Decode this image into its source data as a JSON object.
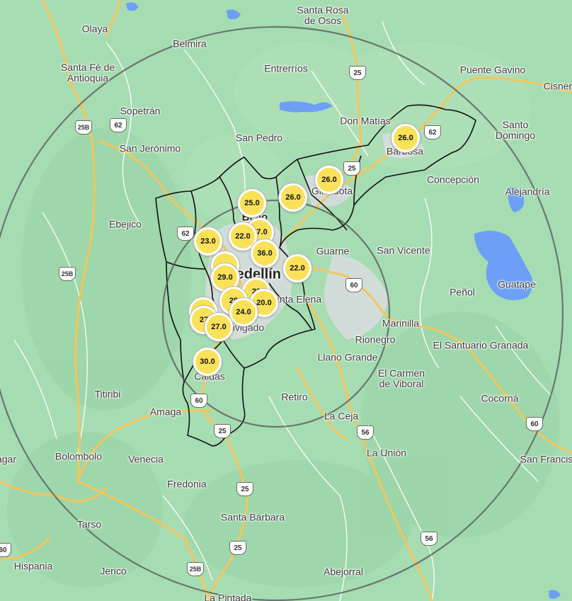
{
  "colors": {
    "land": "#a6dcb2",
    "road": "#f4c55b",
    "water": "#6c9ff5",
    "range_ring": "#555555",
    "boundary": "#111111",
    "marker_fill": "#f9e259"
  },
  "towns": [
    {
      "id": "santa-rosa",
      "label": "Santa Rosa\nde Osos"
    },
    {
      "id": "olaya",
      "label": "Olaya"
    },
    {
      "id": "belmira",
      "label": "Belmira"
    },
    {
      "id": "santa-fe",
      "label": "Santa Fé de\nAntioquia"
    },
    {
      "id": "entrerrios",
      "label": "Entrerríos"
    },
    {
      "id": "puente-gavino",
      "label": "Puente Gavino"
    },
    {
      "id": "cisner",
      "label": "Cisner"
    },
    {
      "id": "sopetran",
      "label": "Sopetrán"
    },
    {
      "id": "don-matias",
      "label": "Don Matías"
    },
    {
      "id": "santo-domingo",
      "label": "Santo\nDomingo"
    },
    {
      "id": "san-jeronimo",
      "label": "San Jerónimo"
    },
    {
      "id": "san-pedro",
      "label": "San Pedro"
    },
    {
      "id": "barbosa",
      "label": "Barbosa"
    },
    {
      "id": "concepcion",
      "label": "Concepción"
    },
    {
      "id": "girardota",
      "label": "Girardota"
    },
    {
      "id": "alejandria",
      "label": "Alejandría"
    },
    {
      "id": "ebejico",
      "label": "Ebejico"
    },
    {
      "id": "bello",
      "label": "Bello"
    },
    {
      "id": "guarne",
      "label": "Guarne"
    },
    {
      "id": "san-vicente",
      "label": "San Vicente"
    },
    {
      "id": "medellin",
      "label": "Medellín"
    },
    {
      "id": "penol",
      "label": "Peñol"
    },
    {
      "id": "guatape",
      "label": "Guatape"
    },
    {
      "id": "santa-elena",
      "label": "Santa Elena"
    },
    {
      "id": "marinilla",
      "label": "Marinilla"
    },
    {
      "id": "envigado",
      "label": "Envigado"
    },
    {
      "id": "el-santuario",
      "label": "El Santuario Granada"
    },
    {
      "id": "rionegro",
      "label": "Rionegro"
    },
    {
      "id": "llano-grande",
      "label": "Llano Grande"
    },
    {
      "id": "el-carmen",
      "label": "El Carmen\nde Viboral"
    },
    {
      "id": "caldas",
      "label": "Caldas"
    },
    {
      "id": "titiribi",
      "label": "Titiribi"
    },
    {
      "id": "retiro",
      "label": "Retiro"
    },
    {
      "id": "cocorna",
      "label": "Cocorná"
    },
    {
      "id": "amaga",
      "label": "Amaga"
    },
    {
      "id": "la-ceja",
      "label": "La Ceja"
    },
    {
      "id": "la-union",
      "label": "La Unión"
    },
    {
      "id": "san-francisco",
      "label": "San Francis"
    },
    {
      "id": "bolombolo",
      "label": "Bolombolo"
    },
    {
      "id": "venecia",
      "label": "Venecia"
    },
    {
      "id": "agar",
      "label": "agar"
    },
    {
      "id": "fredonia",
      "label": "Fredonia"
    },
    {
      "id": "santa-barbara",
      "label": "Santa Bárbara"
    },
    {
      "id": "tarso",
      "label": "Tarso"
    },
    {
      "id": "hispania",
      "label": "Hispania"
    },
    {
      "id": "jerico",
      "label": "Jericó"
    },
    {
      "id": "abejorral",
      "label": "Abejorral"
    },
    {
      "id": "la-pintada",
      "label": "La Pintada"
    }
  ],
  "route_shields": [
    {
      "id": "r25-top",
      "label": "25"
    },
    {
      "id": "r25b-nw",
      "label": "25B"
    },
    {
      "id": "r62-nw",
      "label": "62"
    },
    {
      "id": "r62-ne",
      "label": "62"
    },
    {
      "id": "r25-barbosa",
      "label": "25"
    },
    {
      "id": "r62-med",
      "label": "62"
    },
    {
      "id": "r25b-w",
      "label": "25B"
    },
    {
      "id": "r60-east",
      "label": "60"
    },
    {
      "id": "r60-south",
      "label": "60"
    },
    {
      "id": "r25-south",
      "label": "25"
    },
    {
      "id": "r56-ceja",
      "label": "56"
    },
    {
      "id": "r60-far",
      "label": "60"
    },
    {
      "id": "r25-fredonia",
      "label": "25"
    },
    {
      "id": "r25-sb",
      "label": "25"
    },
    {
      "id": "r56-abejorral",
      "label": "56"
    },
    {
      "id": "r25b-sw",
      "label": "25B"
    },
    {
      "id": "r60-sw",
      "label": "60"
    }
  ],
  "markers": [
    {
      "id": "m-barbosa",
      "value": "26.0"
    },
    {
      "id": "m-girardota",
      "value": "26.0"
    },
    {
      "id": "m-copacabana",
      "value": "26.0"
    },
    {
      "id": "m-bello-n",
      "value": "25.0"
    },
    {
      "id": "m-bello-1",
      "value": "22.0"
    },
    {
      "id": "m-bello-2",
      "value": "27.0"
    },
    {
      "id": "m-west",
      "value": "23.0"
    },
    {
      "id": "m-center",
      "value": "36.0"
    },
    {
      "id": "m-east",
      "value": "22.0"
    },
    {
      "id": "m-med-w1",
      "value": ""
    },
    {
      "id": "m-med-w2",
      "value": "29.0"
    },
    {
      "id": "m-med-s1",
      "value": "23"
    },
    {
      "id": "m-med-s2",
      "value": "28"
    },
    {
      "id": "m-med-s3",
      "value": "24.0"
    },
    {
      "id": "m-med-s4",
      "value": "20.0"
    },
    {
      "id": "m-itagui-1",
      "value": ""
    },
    {
      "id": "m-itagui-2",
      "value": "27"
    },
    {
      "id": "m-itagui-3",
      "value": "27.0"
    },
    {
      "id": "m-caldas",
      "value": "30.0"
    }
  ]
}
